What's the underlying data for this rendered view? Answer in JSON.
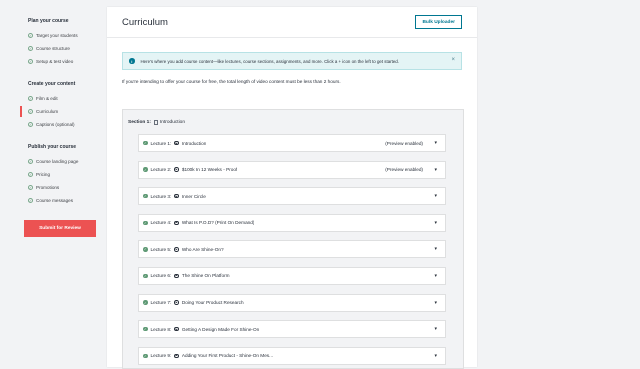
{
  "sidebar": {
    "groups": [
      {
        "title": "Plan your course",
        "items": [
          {
            "label": "Target your students"
          },
          {
            "label": "Course structure"
          },
          {
            "label": "Setup & test video"
          }
        ]
      },
      {
        "title": "Create your content",
        "items": [
          {
            "label": "Film & edit"
          },
          {
            "label": "Curriculum"
          },
          {
            "label": "Captions (optional)"
          }
        ]
      },
      {
        "title": "Publish your course",
        "items": [
          {
            "label": "Course landing page"
          },
          {
            "label": "Pricing"
          },
          {
            "label": "Promotions"
          },
          {
            "label": "Course messages"
          }
        ]
      }
    ],
    "submit_label": "Submit for Review"
  },
  "header": {
    "title": "Curriculum",
    "bulk_uploader_label": "Bulk Uploader"
  },
  "banner": {
    "text": "Here's where you add course content—like lectures, course sections, assignments, and more. Click a + icon on the left to get started.",
    "close": "×"
  },
  "free_note": "If you're intending to offer your course for free, the total length of video content must be less than 2 hours.",
  "section": {
    "label": "Section 1:",
    "title": "Introduction"
  },
  "lectures": [
    {
      "num": "Lecture 1:",
      "title": "Introduction",
      "status": "(Preview enabled)"
    },
    {
      "num": "Lecture 2:",
      "title": "$100k In 12 Weeks - Proof",
      "status": "(Preview enabled)"
    },
    {
      "num": "Lecture 3:",
      "title": "Inner Circle",
      "status": ""
    },
    {
      "num": "Lecture 4:",
      "title": "What Is P.O.D? (Print On Demand)",
      "status": ""
    },
    {
      "num": "Lecture 5:",
      "title": "Who Are Shine-On?",
      "status": ""
    },
    {
      "num": "Lecture 6:",
      "title": "The Shine On Platform",
      "status": ""
    },
    {
      "num": "Lecture 7:",
      "title": "Doing Your Product Research",
      "status": ""
    },
    {
      "num": "Lecture 8:",
      "title": "Getting A Design Made For Shine-On",
      "status": ""
    },
    {
      "num": "Lecture 9:",
      "title": "Adding Your First Product - Shine-On Mes...",
      "status": ""
    }
  ],
  "colors": {
    "accent": "#ec5252",
    "teal": "#007791",
    "success": "#5f9a75"
  },
  "icons": {
    "check": "check-circle-icon",
    "play": "play-circle-icon",
    "chevron": "chevron-down-icon",
    "info": "info-icon",
    "close": "close-icon",
    "doc": "document-icon"
  }
}
